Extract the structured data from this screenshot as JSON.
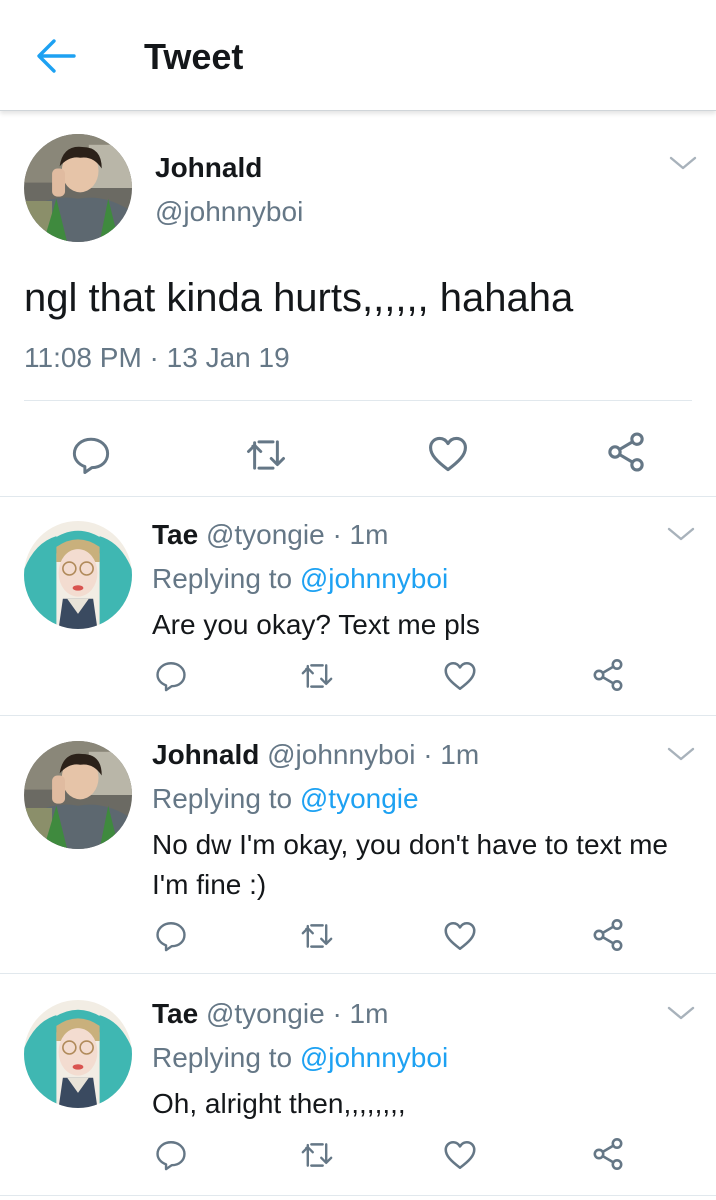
{
  "header": {
    "title": "Tweet",
    "back_icon": "arrow-left-icon",
    "accent": "#1da1f2"
  },
  "main_tweet": {
    "name": "Johnald",
    "handle": "@johnnyboi",
    "text": "ngl that kinda hurts,,,,,, hahaha",
    "timestamp": "11:08 PM · 13 Jan 19",
    "actions": [
      "reply-icon",
      "retweet-icon",
      "like-icon",
      "share-icon"
    ]
  },
  "replies": [
    {
      "name": "Tae",
      "meta": "@tyongie · 1m",
      "replying_prefix": "Replying to ",
      "replying_to": "@johnnyboi",
      "text": "Are you okay? Text me pls"
    },
    {
      "name": "Johnald",
      "meta": "@johnnyboi · 1m",
      "replying_prefix": "Replying to ",
      "replying_to": "@tyongie",
      "text": "No dw I'm okay, you don't have to text me I'm fine :)"
    },
    {
      "name": "Tae",
      "meta": "@tyongie · 1m",
      "replying_prefix": "Replying to ",
      "replying_to": "@johnnyboi",
      "text": "Oh, alright then,,,,,,,,"
    }
  ],
  "colors": {
    "text": "#14171a",
    "secondary": "#657786",
    "link": "#1da1f2",
    "divider": "#e1e8ed"
  }
}
